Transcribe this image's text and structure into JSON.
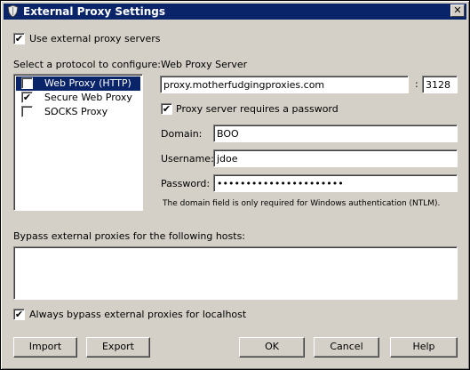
{
  "window": {
    "title": "External Proxy Settings",
    "close_glyph": "✕"
  },
  "use_external": {
    "label": "Use external proxy servers",
    "checked": true
  },
  "protocol": {
    "heading": "Select a protocol to configure:",
    "items": [
      {
        "label": "Web Proxy (HTTP)",
        "checked": true,
        "selected": true
      },
      {
        "label": "Secure Web Proxy ...",
        "checked": true,
        "selected": false
      },
      {
        "label": "SOCKS Proxy",
        "checked": false,
        "selected": false
      }
    ]
  },
  "server": {
    "heading": "Web Proxy Server",
    "host": "proxy.motherfudgingproxies.com",
    "separator": ":",
    "port": "3128",
    "requires_password": {
      "label": "Proxy server requires a password",
      "checked": true
    },
    "domain_label": "Domain:",
    "domain": "BOO",
    "username_label": "Username:",
    "username": "jdoe",
    "password_label": "Password:",
    "password": "••••••••••••••••••••••",
    "note": "The domain field is only required for Windows authentication (NTLM)."
  },
  "bypass": {
    "heading": "Bypass external proxies for the following hosts:",
    "hosts": "",
    "localhost": {
      "label": "Always bypass external proxies for localhost",
      "checked": true
    }
  },
  "buttons": {
    "import": "Import",
    "export": "Export",
    "ok": "OK",
    "cancel": "Cancel",
    "help": "Help"
  },
  "check_glyph": "✔",
  "colors": {
    "titlebar": "#0a246a",
    "selection": "#0a246a",
    "face": "#d4d0c8"
  },
  "icons": {
    "title": "shield-icon"
  }
}
